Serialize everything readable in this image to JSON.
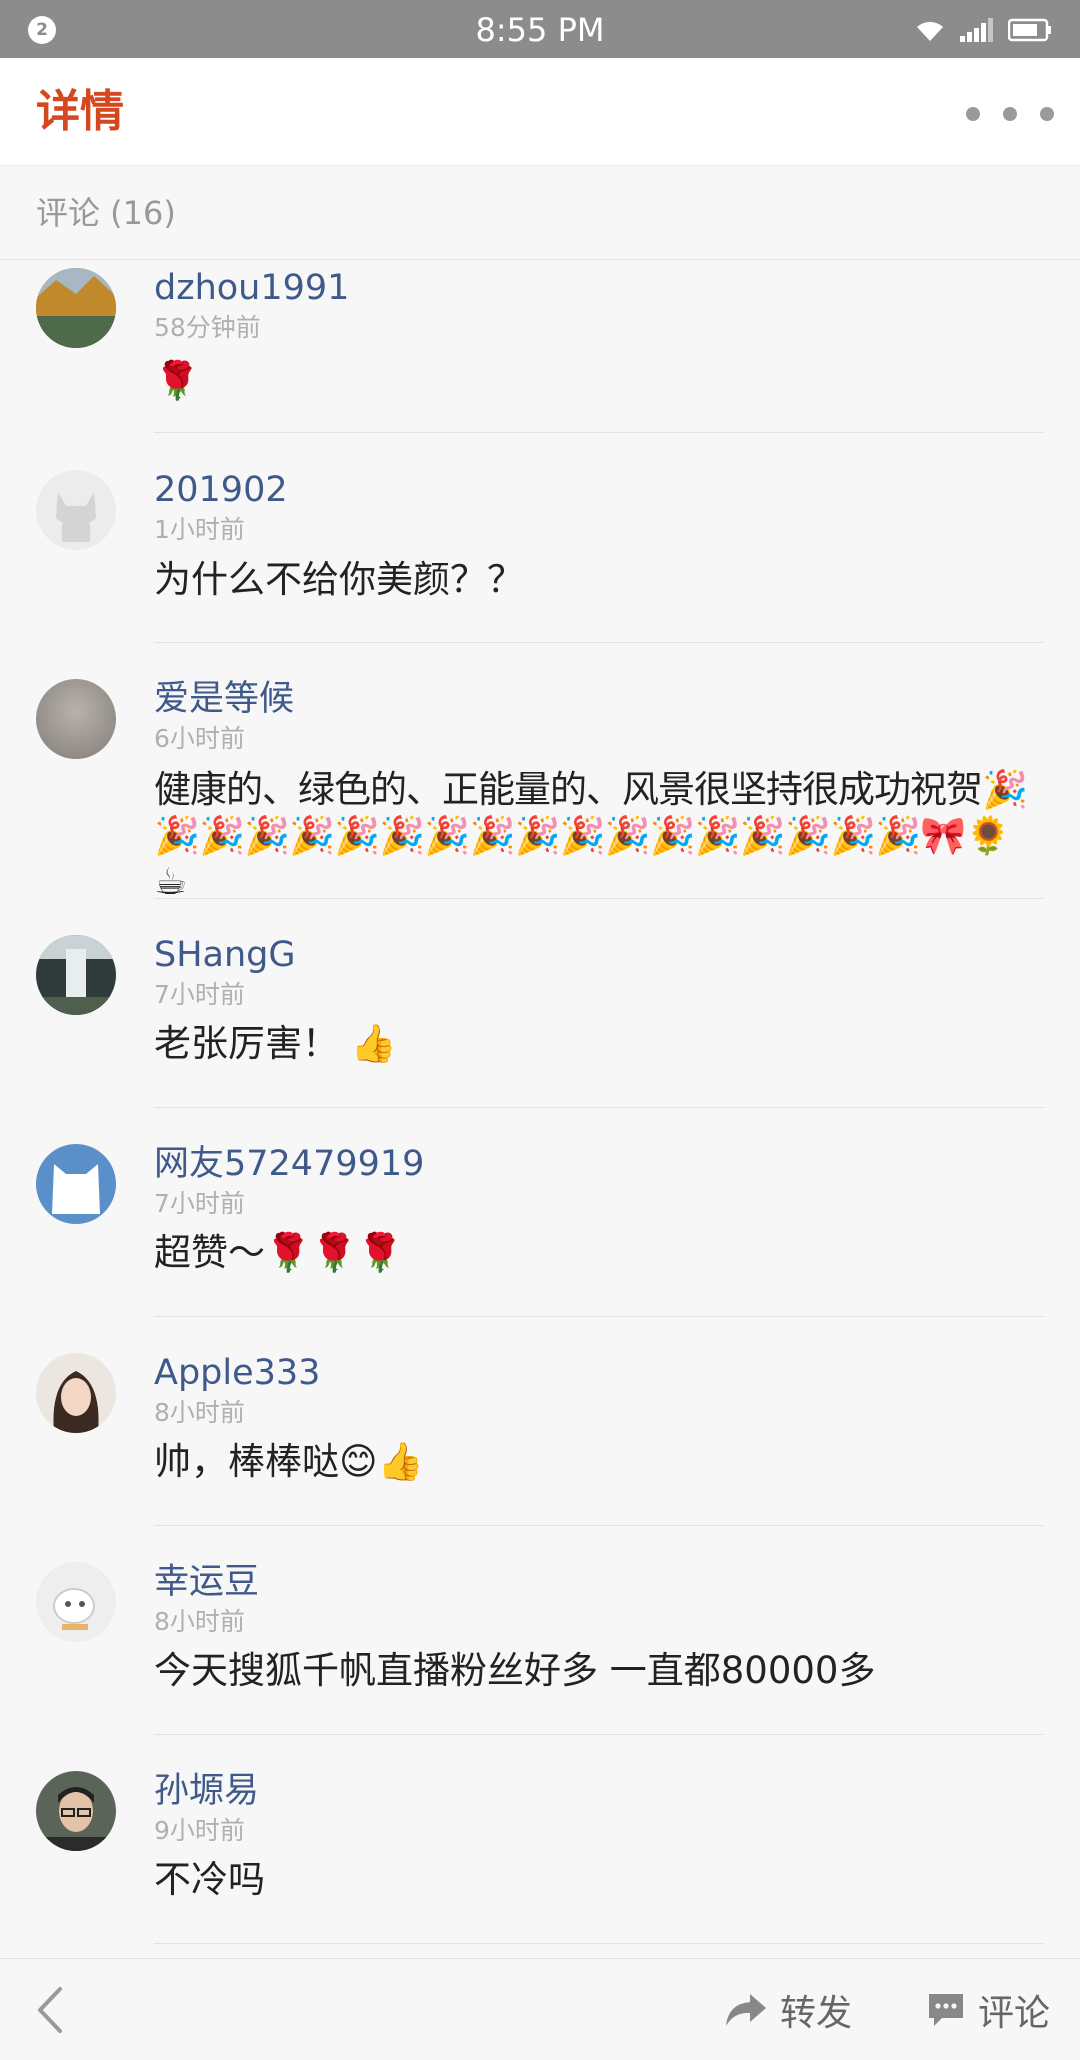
{
  "status_bar": {
    "notification_count": "2",
    "time": "8:55 PM"
  },
  "header": {
    "title": "详情"
  },
  "comments_header": {
    "label": "评论 (16)"
  },
  "comments": [
    {
      "name": "dzhou1991",
      "time": "58分钟前",
      "text": "🌹"
    },
    {
      "name": "201902",
      "time": "1小时前",
      "text": "为什么不给你美颜？？"
    },
    {
      "name": "爱是等候",
      "time": "6小时前",
      "text": "健康的、绿色的、正能量的、风景很坚持很成功祝贺🎉🎉🎉🎉🎉🎉🎉🎉🎉🎉🎉🎉🎉🎉🎉🎉🎉🎉🎀🌻☕"
    },
    {
      "name": "SHangG",
      "time": "7小时前",
      "text": "老张厉害！ 👍"
    },
    {
      "name": "网友572479919",
      "time": "7小时前",
      "text": "超赞～🌹🌹🌹"
    },
    {
      "name": "Apple333",
      "time": "8小时前",
      "text": "帅，棒棒哒😊👍"
    },
    {
      "name": "幸运豆",
      "time": "8小时前",
      "text": "今天搜狐千帆直播粉丝好多  一直都80000多"
    },
    {
      "name": "孙塬易",
      "time": "9小时前",
      "text": "不冷吗"
    }
  ],
  "bottom_bar": {
    "forward_label": "转发",
    "comment_label": "评论"
  }
}
